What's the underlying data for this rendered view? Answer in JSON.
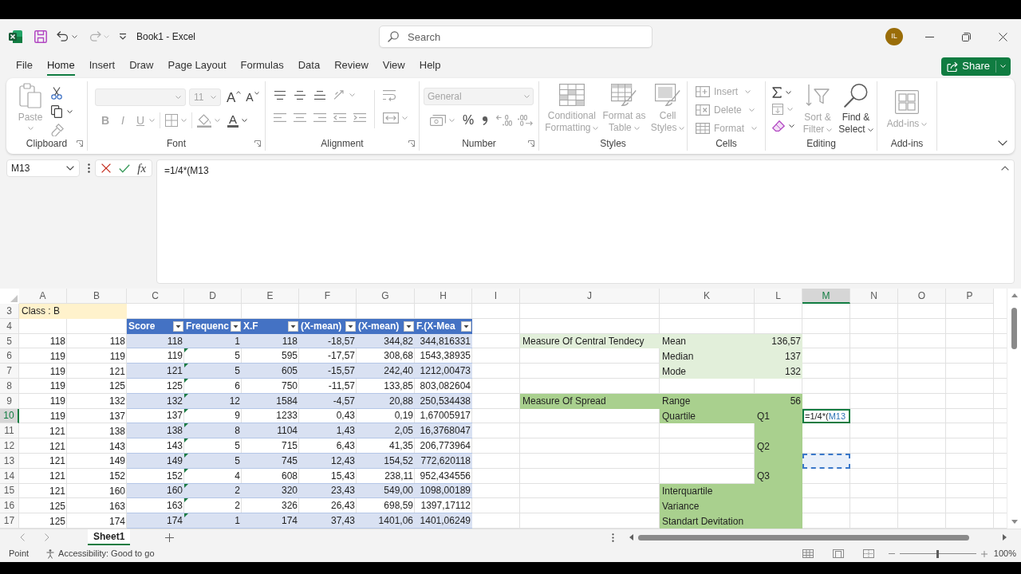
{
  "title_bar": {
    "title": "Book1 - Excel",
    "search": {
      "placeholder": "Search"
    },
    "account": {
      "initials": "IL"
    }
  },
  "menu": {
    "tabs": [
      {
        "label": "File",
        "selected": false
      },
      {
        "label": "Home",
        "selected": true
      },
      {
        "label": "Insert",
        "selected": false
      },
      {
        "label": "Draw",
        "selected": false
      },
      {
        "label": "Page Layout",
        "selected": false
      },
      {
        "label": "Formulas",
        "selected": false
      },
      {
        "label": "Data",
        "selected": false
      },
      {
        "label": "Review",
        "selected": false
      },
      {
        "label": "View",
        "selected": false
      },
      {
        "label": "Help",
        "selected": false
      }
    ],
    "share": {
      "label": "Share"
    }
  },
  "ribbon": {
    "clipboard": {
      "label": "Clipboard",
      "launcher": true,
      "paste": {
        "label": "Paste",
        "disabled": true
      }
    },
    "font": {
      "label": "Font",
      "launcher": true,
      "font_size": {
        "value": "11",
        "disabled": true
      },
      "grow_font": {
        "label": "A",
        "disabled": false
      },
      "shrink_font": {
        "label": "A",
        "disabled": false
      },
      "bold": {
        "label": "B",
        "disabled": true
      },
      "italic": {
        "label": "I",
        "disabled": true
      },
      "underline": {
        "label": "U",
        "disabled": true
      },
      "font_color": {
        "label": "A",
        "disabled": false
      }
    },
    "alignment": {
      "label": "Alignment",
      "launcher": true
    },
    "number": {
      "label": "Number",
      "launcher": true,
      "format": {
        "value": "General",
        "disabled": true
      },
      "percent": {
        "label": "%",
        "disabled": false
      }
    },
    "styles": {
      "label": "Styles",
      "buttons": [
        {
          "label": "Conditional Formatting",
          "disabled": true
        },
        {
          "label": "Format as Table",
          "disabled": true
        },
        {
          "label": "Cell Styles",
          "disabled": true
        }
      ]
    },
    "cells": {
      "label": "Cells",
      "buttons": [
        {
          "label": "Insert",
          "disabled": true
        },
        {
          "label": "Delete",
          "disabled": true
        },
        {
          "label": "Format",
          "disabled": true
        }
      ]
    },
    "editing": {
      "label": "Editing",
      "buttons": [
        {
          "label": "Sort & Filter",
          "disabled": true
        },
        {
          "label": "Find & Select",
          "disabled": false
        }
      ]
    },
    "add_ins": {
      "label": "Add-ins",
      "button": {
        "label": "Add-ins",
        "disabled": true
      }
    }
  },
  "formula_bar": {
    "name_box": "M13",
    "function_label": "fx",
    "formula": "=1/4*(M13"
  },
  "sheet": {
    "columns": [
      {
        "label": "A",
        "selected": false
      },
      {
        "label": "B",
        "selected": false
      },
      {
        "label": "C",
        "selected": false
      },
      {
        "label": "D",
        "selected": false
      },
      {
        "label": "E",
        "selected": false
      },
      {
        "label": "F",
        "selected": false
      },
      {
        "label": "G",
        "selected": false
      },
      {
        "label": "H",
        "selected": false
      },
      {
        "label": "I",
        "selected": false
      },
      {
        "label": "J",
        "selected": false
      },
      {
        "label": "K",
        "selected": false
      },
      {
        "label": "L",
        "selected": false
      },
      {
        "label": "M",
        "selected": true
      },
      {
        "label": "N",
        "selected": false
      },
      {
        "label": "O",
        "selected": false
      },
      {
        "label": "P",
        "selected": false
      }
    ],
    "rows": [
      {
        "label": "3",
        "selected": false,
        "cells": [
          {
            "text": "Class : B",
            "kind": "title"
          },
          {
            "kind": "title"
          }
        ]
      },
      {
        "label": "4",
        "selected": false,
        "cells": [
          {},
          {},
          {
            "text": "Score",
            "kind": "header"
          },
          {
            "text": "Frequenc",
            "kind": "header"
          },
          {
            "text": "X.F",
            "kind": "header"
          },
          {
            "text": "(X-mean)",
            "kind": "header"
          },
          {
            "text": "(X-mean)",
            "kind": "header"
          },
          {
            "text": "F.(X-Mea",
            "kind": "header"
          }
        ]
      },
      {
        "label": "5",
        "selected": false,
        "cells": [
          {
            "text": "118",
            "numeric": true
          },
          {
            "text": "118",
            "numeric": true
          },
          {
            "text": "118",
            "numeric": true,
            "kind": "band"
          },
          {
            "text": "1",
            "numeric": true,
            "kind": "band",
            "flag": false
          },
          {
            "text": "118",
            "numeric": true,
            "kind": "band"
          },
          {
            "text": "-18,57",
            "numeric": true,
            "kind": "band"
          },
          {
            "text": "344,82",
            "numeric": true,
            "kind": "band"
          },
          {
            "text": "344,816331",
            "numeric": true,
            "kind": "band"
          },
          {},
          {
            "text": "Measure Of Central Tendecy",
            "kind": "central"
          },
          {
            "text": "Mean",
            "kind": "central"
          },
          {
            "text": "136,57",
            "numeric": true,
            "kind": "central"
          }
        ]
      },
      {
        "label": "6",
        "selected": false,
        "cells": [
          {
            "text": "119",
            "numeric": true
          },
          {
            "text": "119",
            "numeric": true
          },
          {
            "text": "119",
            "numeric": true,
            "kind": "table"
          },
          {
            "text": "5",
            "numeric": true,
            "kind": "table",
            "flag": true
          },
          {
            "text": "595",
            "numeric": true,
            "kind": "table"
          },
          {
            "text": "-17,57",
            "numeric": true,
            "kind": "table"
          },
          {
            "text": "308,68",
            "numeric": true,
            "kind": "table"
          },
          {
            "text": "1543,38935",
            "numeric": true,
            "kind": "table"
          },
          {},
          {},
          {
            "text": "Median",
            "kind": "central"
          },
          {
            "text": "137",
            "numeric": true,
            "kind": "central"
          }
        ]
      },
      {
        "label": "7",
        "selected": false,
        "cells": [
          {
            "text": "119",
            "numeric": true
          },
          {
            "text": "121",
            "numeric": true
          },
          {
            "text": "121",
            "numeric": true,
            "kind": "band"
          },
          {
            "text": "5",
            "numeric": true,
            "kind": "band",
            "flag": true
          },
          {
            "text": "605",
            "numeric": true,
            "kind": "band"
          },
          {
            "text": "-15,57",
            "numeric": true,
            "kind": "band"
          },
          {
            "text": "242,40",
            "numeric": true,
            "kind": "band"
          },
          {
            "text": "1212,00473",
            "numeric": true,
            "kind": "band"
          },
          {},
          {},
          {
            "text": "Mode",
            "kind": "central"
          },
          {
            "text": "132",
            "numeric": true,
            "kind": "central"
          }
        ]
      },
      {
        "label": "8",
        "selected": false,
        "cells": [
          {
            "text": "119",
            "numeric": true
          },
          {
            "text": "125",
            "numeric": true
          },
          {
            "text": "125",
            "numeric": true,
            "kind": "table"
          },
          {
            "text": "6",
            "numeric": true,
            "kind": "table",
            "flag": true
          },
          {
            "text": "750",
            "numeric": true,
            "kind": "table"
          },
          {
            "text": "-11,57",
            "numeric": true,
            "kind": "table"
          },
          {
            "text": "133,85",
            "numeric": true,
            "kind": "table"
          },
          {
            "text": "803,082604",
            "numeric": true,
            "kind": "table"
          }
        ]
      },
      {
        "label": "9",
        "selected": false,
        "cells": [
          {
            "text": "119",
            "numeric": true
          },
          {
            "text": "132",
            "numeric": true
          },
          {
            "text": "132",
            "numeric": true,
            "kind": "band"
          },
          {
            "text": "12",
            "numeric": true,
            "kind": "band",
            "flag": true
          },
          {
            "text": "1584",
            "numeric": true,
            "kind": "band"
          },
          {
            "text": "-4,57",
            "numeric": true,
            "kind": "band"
          },
          {
            "text": "20,88",
            "numeric": true,
            "kind": "band"
          },
          {
            "text": "250,534438",
            "numeric": true,
            "kind": "band"
          },
          {},
          {
            "text": "Measure Of Spread",
            "kind": "spread"
          },
          {
            "text": "Range",
            "kind": "spread"
          },
          {
            "text": "56",
            "numeric": true,
            "kind": "spread"
          }
        ]
      },
      {
        "label": "10",
        "selected": true,
        "cells": [
          {
            "text": "119",
            "numeric": true
          },
          {
            "text": "137",
            "numeric": true
          },
          {
            "text": "137",
            "numeric": true,
            "kind": "table"
          },
          {
            "text": "9",
            "numeric": true,
            "kind": "table",
            "flag": true
          },
          {
            "text": "1233",
            "numeric": true,
            "kind": "table"
          },
          {
            "text": "0,43",
            "numeric": true,
            "kind": "table"
          },
          {
            "text": "0,19",
            "numeric": true,
            "kind": "table"
          },
          {
            "text": "1,67005917",
            "numeric": true,
            "kind": "table"
          },
          {},
          {},
          {
            "text": "Quartile",
            "kind": "spread"
          },
          {
            "text": "Q1",
            "kind": "spread"
          },
          {
            "parts": [
              {
                "text": "=1/4*(",
                "kind": "text"
              },
              {
                "text": "M13",
                "kind": "reference"
              }
            ],
            "active": true
          }
        ]
      },
      {
        "label": "11",
        "selected": false,
        "cells": [
          {
            "text": "121",
            "numeric": true
          },
          {
            "text": "138",
            "numeric": true
          },
          {
            "text": "138",
            "numeric": true,
            "kind": "band"
          },
          {
            "text": "8",
            "numeric": true,
            "kind": "band",
            "flag": true
          },
          {
            "text": "1104",
            "numeric": true,
            "kind": "band"
          },
          {
            "text": "1,43",
            "numeric": true,
            "kind": "band"
          },
          {
            "text": "2,05",
            "numeric": true,
            "kind": "band"
          },
          {
            "text": "16,3768047",
            "numeric": true,
            "kind": "band"
          },
          {},
          {},
          {},
          {
            "kind": "spread"
          }
        ]
      },
      {
        "label": "12",
        "selected": false,
        "cells": [
          {
            "text": "121",
            "numeric": true
          },
          {
            "text": "143",
            "numeric": true
          },
          {
            "text": "143",
            "numeric": true,
            "kind": "table"
          },
          {
            "text": "5",
            "numeric": true,
            "kind": "table",
            "flag": true
          },
          {
            "text": "715",
            "numeric": true,
            "kind": "table"
          },
          {
            "text": "6,43",
            "numeric": true,
            "kind": "table"
          },
          {
            "text": "41,35",
            "numeric": true,
            "kind": "table"
          },
          {
            "text": "206,773964",
            "numeric": true,
            "kind": "table"
          },
          {},
          {},
          {},
          {
            "text": "Q2",
            "kind": "spread"
          }
        ]
      },
      {
        "label": "13",
        "selected": false,
        "cells": [
          {
            "text": "121",
            "numeric": true
          },
          {
            "text": "149",
            "numeric": true
          },
          {
            "text": "149",
            "numeric": true,
            "kind": "band"
          },
          {
            "text": "5",
            "numeric": true,
            "kind": "band",
            "flag": true
          },
          {
            "text": "745",
            "numeric": true,
            "kind": "band"
          },
          {
            "text": "12,43",
            "numeric": true,
            "kind": "band"
          },
          {
            "text": "154,52",
            "numeric": true,
            "kind": "band"
          },
          {
            "text": "772,620118",
            "numeric": true,
            "kind": "band"
          },
          {},
          {},
          {},
          {
            "kind": "spread"
          },
          {
            "referenced": true
          }
        ]
      },
      {
        "label": "14",
        "selected": false,
        "cells": [
          {
            "text": "121",
            "numeric": true
          },
          {
            "text": "152",
            "numeric": true
          },
          {
            "text": "152",
            "numeric": true,
            "kind": "table"
          },
          {
            "text": "4",
            "numeric": true,
            "kind": "table",
            "flag": true
          },
          {
            "text": "608",
            "numeric": true,
            "kind": "table"
          },
          {
            "text": "15,43",
            "numeric": true,
            "kind": "table"
          },
          {
            "text": "238,11",
            "numeric": true,
            "kind": "table"
          },
          {
            "text": "952,434556",
            "numeric": true,
            "kind": "table"
          },
          {},
          {},
          {},
          {
            "text": "Q3",
            "kind": "spread"
          }
        ]
      },
      {
        "label": "15",
        "selected": false,
        "cells": [
          {
            "text": "121",
            "numeric": true
          },
          {
            "text": "160",
            "numeric": true
          },
          {
            "text": "160",
            "numeric": true,
            "kind": "band"
          },
          {
            "text": "2",
            "numeric": true,
            "kind": "band",
            "flag": true
          },
          {
            "text": "320",
            "numeric": true,
            "kind": "band"
          },
          {
            "text": "23,43",
            "numeric": true,
            "kind": "band"
          },
          {
            "text": "549,00",
            "numeric": true,
            "kind": "band"
          },
          {
            "text": "1098,00189",
            "numeric": true,
            "kind": "band"
          },
          {},
          {},
          {
            "text": "Interquartile",
            "kind": "spread"
          },
          {
            "kind": "spread"
          }
        ]
      },
      {
        "label": "16",
        "selected": false,
        "cells": [
          {
            "text": "125",
            "numeric": true
          },
          {
            "text": "163",
            "numeric": true
          },
          {
            "text": "163",
            "numeric": true,
            "kind": "table"
          },
          {
            "text": "2",
            "numeric": true,
            "kind": "table",
            "flag": true
          },
          {
            "text": "326",
            "numeric": true,
            "kind": "table"
          },
          {
            "text": "26,43",
            "numeric": true,
            "kind": "table"
          },
          {
            "text": "698,59",
            "numeric": true,
            "kind": "table"
          },
          {
            "text": "1397,17112",
            "numeric": true,
            "kind": "table"
          },
          {},
          {},
          {
            "text": "Variance",
            "kind": "spread"
          },
          {
            "kind": "spread"
          }
        ]
      },
      {
        "label": "17",
        "selected": false,
        "cells": [
          {
            "text": "125",
            "numeric": true
          },
          {
            "text": "174",
            "numeric": true
          },
          {
            "text": "174",
            "numeric": true,
            "kind": "band"
          },
          {
            "text": "1",
            "numeric": true,
            "kind": "band",
            "flag": true
          },
          {
            "text": "174",
            "numeric": true,
            "kind": "band"
          },
          {
            "text": "37,43",
            "numeric": true,
            "kind": "band"
          },
          {
            "text": "1401,06",
            "numeric": true,
            "kind": "band"
          },
          {
            "text": "1401,06249",
            "numeric": true,
            "kind": "band"
          },
          {},
          {},
          {
            "text": "Standart Devitation",
            "kind": "spread"
          },
          {
            "kind": "spread"
          }
        ]
      }
    ]
  },
  "sheet_tabs": [
    {
      "label": "Sheet1",
      "selected": true
    }
  ],
  "status_bar": {
    "mode": "Point",
    "accessibility": "Accessibility: Good to go",
    "zoom": {
      "level": 0.5,
      "reading": "100%"
    }
  }
}
